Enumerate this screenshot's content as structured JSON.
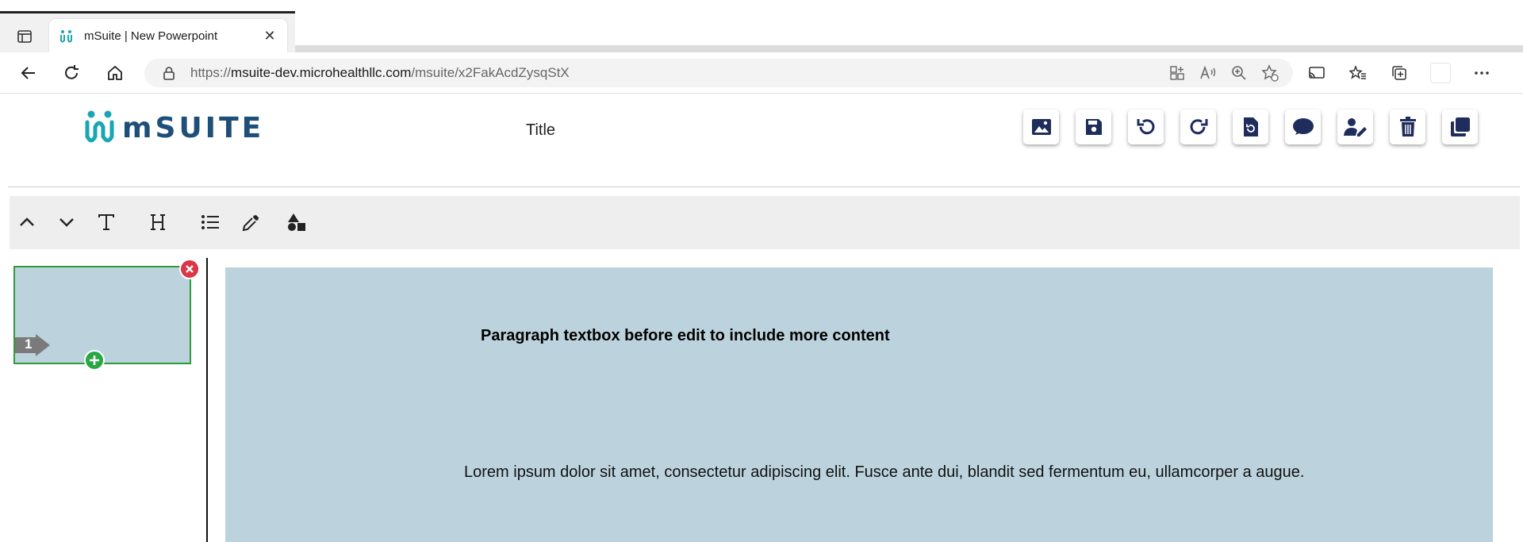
{
  "browser": {
    "tab_title": "mSuite | New Powerpoint",
    "url_prefix": "https://",
    "url_host": "msuite-dev.microhealthllc.com",
    "url_path": "/msuite/x2FakAcdZysqStX"
  },
  "app": {
    "logo_text": "mSUITE",
    "document_title": "Title",
    "brand_color": "#1e4f7a",
    "accent_color": "#1aa5b5",
    "tools": [
      {
        "icon": "image-icon"
      },
      {
        "icon": "save-icon"
      },
      {
        "icon": "undo-icon"
      },
      {
        "icon": "redo-icon"
      },
      {
        "icon": "file-restore-icon"
      },
      {
        "icon": "comment-icon"
      },
      {
        "icon": "user-edit-icon"
      },
      {
        "icon": "trash-icon"
      },
      {
        "icon": "copy-icon"
      }
    ],
    "edit_toolbar": [
      {
        "icon": "chevron-up-icon"
      },
      {
        "icon": "chevron-down-icon"
      },
      {
        "icon": "text-icon"
      },
      {
        "icon": "heading-icon"
      },
      {
        "icon": "list-icon"
      },
      {
        "icon": "eyedropper-icon"
      },
      {
        "icon": "shapes-icon"
      }
    ]
  },
  "slides": [
    {
      "number": "1",
      "background": "#bcd3dd"
    }
  ],
  "canvas": {
    "background": "#bcd3dd",
    "paragraph_title": "Paragraph textbox before edit to include more content",
    "body_text": "Lorem ipsum dolor sit amet, consectetur adipiscing elit. Fusce ante dui, blandit sed fermentum eu, ullamcorper a augue."
  }
}
